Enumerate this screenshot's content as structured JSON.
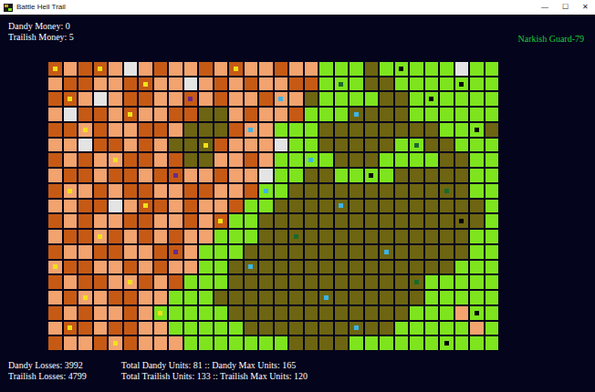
{
  "window": {
    "title": "Battle Hell Trail",
    "controls": [
      "—",
      "☐",
      "✕"
    ]
  },
  "hud": {
    "top_left": [
      "Dandy Money: 0",
      "Trailish Money: 5"
    ],
    "top_right": "Narkish Guard-79",
    "bottom_left": [
      "Dandy Losses: 3992",
      "Trailish Losses: 4799"
    ],
    "bottom_right": [
      "Total Dandy Units: 81 :: Dandy Max Units: 165",
      "Total Trailish Units: 133 :: Trailish Max Units: 120"
    ]
  },
  "grid": {
    "palette": {
      "O": "#c65a14",
      "P": "#f2a36e",
      "G": "#7ee41e",
      "L": "#6d6512",
      "W": "#e4e4e4"
    },
    "rows": [
      "OPOOPWPOPPOPOPPOPPGGGLGGGGGWGG",
      "POOPPOOPPWPOPOPPOOGGGLLGGGGGGG",
      "OOPWPOOPPOPOPPOPPLGGGGLLGGGGGG",
      "PWOOPOPPOOLLPOPPOGGGLLLLGGGGGG",
      "OOPOPPOOPLLLOPPGGGLLLLLLLLGGGL",
      "PPWOOPOPLLLOPPPWGGLLLLLGGLLGGG",
      "OPOPPOOPOLLPPOPGGGGLLLGGGGLLGG",
      "POOPOOPOOPPOPPWGGLLGGGGLLLLLGG",
      "OPPOPOOPPOOPPOGGLLLLLLLLLLLLGG",
      "PPOOWPOOPOPPOGGLLLLLLLLLLLLLLG",
      "OPOPPOOPPOPOGGLLLLLLLLLLLLLLLG",
      "POOPOPOPOPPGGGLLLLLLLLLLLLLLGG",
      "OPPOOPPOOPGGGLLLLLLLLLLLLLLLGG",
      "POOPPOPOPPGGLLLLLLLLLLLLLLLGGG",
      "OPOOPPOPOGGGLLLLLLLLLLLLLGGGGG",
      "POPPOOPPGGGLLLLLLLLLLLLLLGGGGG",
      "OPOPPOPGGGGGLLLLLLLLLLLLGGGPGG",
      "POOPOOPPGGGGGLLLLLLLLLLGGGGGPG",
      "OPPOPOPPPGGGGGGGLLLLGGGGGGGGGG"
    ]
  },
  "units": [
    {
      "r": 0,
      "c": 0,
      "color": "#f2e01a"
    },
    {
      "r": 0,
      "c": 3,
      "color": "#f2e01a"
    },
    {
      "r": 0,
      "c": 12,
      "color": "#f2e01a"
    },
    {
      "r": 0,
      "c": 23,
      "color": "#000000"
    },
    {
      "r": 1,
      "c": 6,
      "color": "#f2e01a"
    },
    {
      "r": 1,
      "c": 19,
      "color": "#1a6a2a"
    },
    {
      "r": 1,
      "c": 27,
      "color": "#000000"
    },
    {
      "r": 2,
      "c": 1,
      "color": "#f2e01a"
    },
    {
      "r": 2,
      "c": 9,
      "color": "#6a2a8a"
    },
    {
      "r": 2,
      "c": 15,
      "color": "#3cb4e6"
    },
    {
      "r": 2,
      "c": 25,
      "color": "#000000"
    },
    {
      "r": 3,
      "c": 5,
      "color": "#f2e01a"
    },
    {
      "r": 3,
      "c": 20,
      "color": "#3cb4e6"
    },
    {
      "r": 4,
      "c": 2,
      "color": "#f2e01a"
    },
    {
      "r": 4,
      "c": 13,
      "color": "#3cb4e6"
    },
    {
      "r": 4,
      "c": 28,
      "color": "#000000"
    },
    {
      "r": 5,
      "c": 10,
      "color": "#f2e01a"
    },
    {
      "r": 5,
      "c": 24,
      "color": "#1a6a2a"
    },
    {
      "r": 6,
      "c": 4,
      "color": "#f2e01a"
    },
    {
      "r": 6,
      "c": 17,
      "color": "#3cb4e6"
    },
    {
      "r": 7,
      "c": 8,
      "color": "#6a2a8a"
    },
    {
      "r": 7,
      "c": 21,
      "color": "#000000"
    },
    {
      "r": 8,
      "c": 1,
      "color": "#f2e01a"
    },
    {
      "r": 8,
      "c": 14,
      "color": "#3cb4e6"
    },
    {
      "r": 8,
      "c": 26,
      "color": "#1a6a2a"
    },
    {
      "r": 9,
      "c": 6,
      "color": "#f2e01a"
    },
    {
      "r": 9,
      "c": 19,
      "color": "#3cb4e6"
    },
    {
      "r": 10,
      "c": 11,
      "color": "#f2e01a"
    },
    {
      "r": 10,
      "c": 27,
      "color": "#000000"
    },
    {
      "r": 11,
      "c": 3,
      "color": "#f2e01a"
    },
    {
      "r": 11,
      "c": 16,
      "color": "#1a6a2a"
    },
    {
      "r": 12,
      "c": 8,
      "color": "#6a2a8a"
    },
    {
      "r": 12,
      "c": 22,
      "color": "#3cb4e6"
    },
    {
      "r": 13,
      "c": 0,
      "color": "#f2e01a"
    },
    {
      "r": 13,
      "c": 13,
      "color": "#3cb4e6"
    },
    {
      "r": 14,
      "c": 5,
      "color": "#f2e01a"
    },
    {
      "r": 14,
      "c": 24,
      "color": "#1a6a2a"
    },
    {
      "r": 15,
      "c": 2,
      "color": "#f2e01a"
    },
    {
      "r": 15,
      "c": 18,
      "color": "#3cb4e6"
    },
    {
      "r": 16,
      "c": 7,
      "color": "#f2e01a"
    },
    {
      "r": 16,
      "c": 28,
      "color": "#000000"
    },
    {
      "r": 17,
      "c": 1,
      "color": "#f2e01a"
    },
    {
      "r": 17,
      "c": 20,
      "color": "#3cb4e6"
    },
    {
      "r": 18,
      "c": 4,
      "color": "#f2e01a"
    },
    {
      "r": 18,
      "c": 26,
      "color": "#000000"
    }
  ]
}
